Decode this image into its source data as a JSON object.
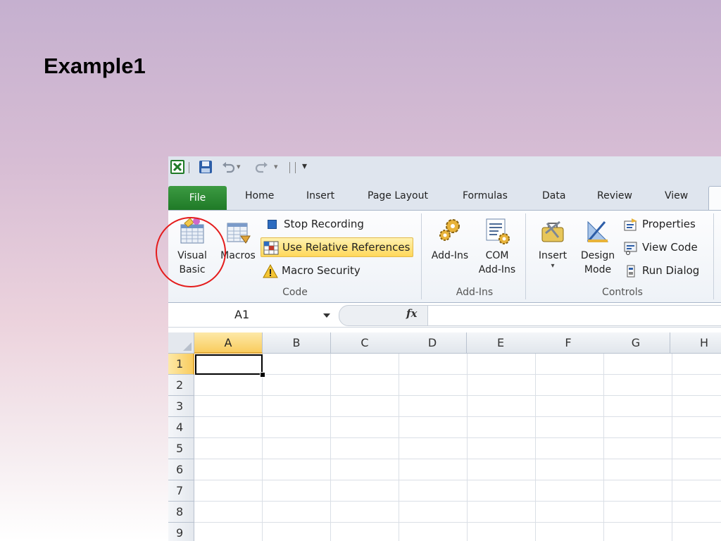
{
  "slide": {
    "title": "Example1"
  },
  "qat": {
    "more_glyph": "▾"
  },
  "tabs": {
    "file": "File",
    "items": [
      "Home",
      "Insert",
      "Page Layout",
      "Formulas",
      "Data",
      "Review",
      "View"
    ]
  },
  "ribbon": {
    "code": {
      "label": "Code",
      "visual_basic": [
        "Visual",
        "Basic"
      ],
      "macros": "Macros",
      "stop_recording": "Stop Recording",
      "use_relative_references": "Use Relative References",
      "macro_security": "Macro Security"
    },
    "addins": {
      "label": "Add-Ins",
      "add_ins": "Add-Ins",
      "com_add_ins": [
        "COM",
        "Add-Ins"
      ]
    },
    "controls": {
      "label": "Controls",
      "insert": "Insert",
      "insert_arrow": "▾",
      "design_mode": [
        "Design",
        "Mode"
      ],
      "properties": "Properties",
      "view_code": "View Code",
      "run_dialog": "Run Dialog"
    }
  },
  "formula_bar": {
    "name_box": "A1",
    "fx": "fx",
    "value": ""
  },
  "grid": {
    "columns": [
      "A",
      "B",
      "C",
      "D",
      "E",
      "F",
      "G",
      "H"
    ],
    "rows": [
      "1",
      "2",
      "3",
      "4",
      "5",
      "6",
      "7",
      "8",
      "9"
    ],
    "active_cell": "A1"
  },
  "colors": {
    "file_tab": "#2a8a32",
    "annotation_circle": "#e41c1c",
    "selection_header": "#f9cc5e"
  }
}
